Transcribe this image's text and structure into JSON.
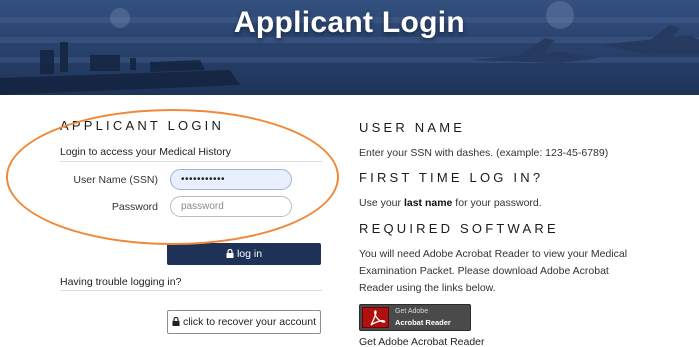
{
  "banner": {
    "title": "Applicant Login"
  },
  "login_panel": {
    "heading": "APPLICANT LOGIN",
    "subheading": "Login to access your Medical History",
    "username_label": "User Name (SSN)",
    "username_value": "•••••••••••",
    "password_label": "Password",
    "password_placeholder": "password",
    "login_button": "log in",
    "trouble_text": "Having trouble logging in?",
    "recover_button": "click to recover your account"
  },
  "info_panel": {
    "user_name_heading": "USER NAME",
    "user_name_text": "Enter your SSN with dashes. (example: 123-45-6789)",
    "first_time_heading": "FIRST TIME LOG IN?",
    "first_time_prefix": "Use your ",
    "first_time_bold": "last name",
    "first_time_suffix": " for your password.",
    "software_heading": "REQUIRED SOFTWARE",
    "software_line1": "You will need Adobe Acrobat Reader to view your Medical",
    "software_line2": "Examination Packet. Please download Adobe Acrobat",
    "software_line3": "Reader using the links below.",
    "badge_line1": "Get Adobe",
    "badge_line2": "Acrobat Reader",
    "acrobat_link": "Get Adobe Acrobat Reader"
  },
  "colors": {
    "banner": "#2a3f6e",
    "login_button": "#1e3258",
    "annotation": "#f0883a",
    "acrobat_red": "#b01010"
  }
}
